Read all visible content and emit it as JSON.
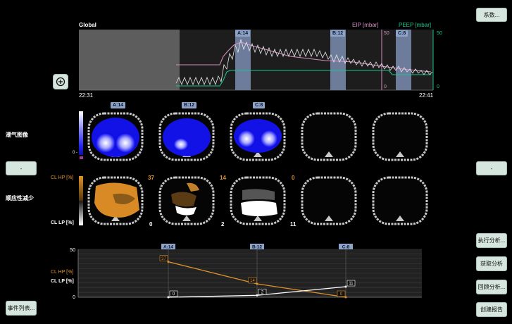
{
  "header": {
    "title": "Global",
    "eip_label": "EIP [mbar]",
    "peep_label": "PEEP [mbar]",
    "eip_max": "50",
    "eip_min": "0",
    "peep_max": "50",
    "peep_min": "0",
    "time_start": "22:31",
    "time_end": "22:41",
    "markers": [
      "A:14",
      "B:12",
      "C:8"
    ]
  },
  "buttons": {
    "params": "系数...",
    "left_small": "-",
    "right_small": "-",
    "events": "事件列表...",
    "run_analysis": "执行分析...",
    "get_analysis": "获取分析",
    "close_analysis": "回顾分析...",
    "create_report": "创建报告"
  },
  "labels": {
    "vent_image": "潮气图像",
    "compliance": "顺应性减少",
    "scale_min": "0 -",
    "cl_hp": "CL HP [%]",
    "cl_lp": "CL LP [%]"
  },
  "vent_row": {
    "tags": [
      "A:14",
      "B:12",
      "C:8"
    ]
  },
  "compliance_row": {
    "hp_values": [
      "37",
      "14",
      "0"
    ],
    "lp_values": [
      "0",
      "2",
      "11"
    ]
  },
  "colors": {
    "eip": "#d58fbf",
    "peep": "#1cc58a",
    "hp": "#e0932a",
    "lp": "#ffffff",
    "marker": "#8ea3c8",
    "button": "#d6e6df"
  },
  "chart_data": {
    "type": "line",
    "categories": [
      "A:14",
      "B:12",
      "C:8"
    ],
    "ylim": [
      0,
      50
    ],
    "yticks": [
      "50",
      "0"
    ],
    "series": [
      {
        "name": "CL HP [%]",
        "values": [
          37,
          14,
          0
        ],
        "labels": [
          "37",
          "14",
          "0"
        ]
      },
      {
        "name": "CL LP [%]",
        "values": [
          0,
          2,
          11
        ],
        "labels": [
          "0",
          "2",
          "11"
        ]
      }
    ]
  }
}
